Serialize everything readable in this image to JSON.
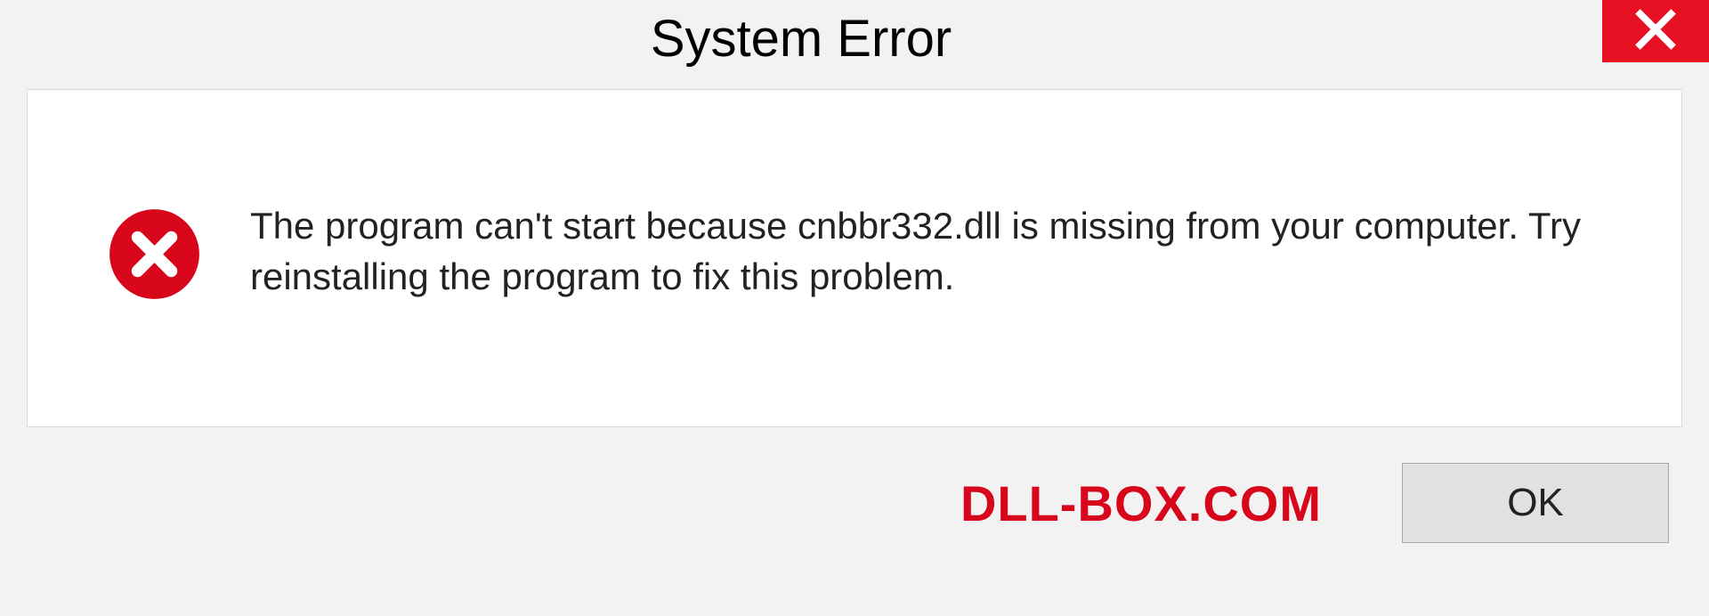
{
  "titlebar": {
    "title": "System Error"
  },
  "dialog": {
    "message": "The program can't start because cnbbr332.dll is missing from your computer. Try reinstalling the program to fix this problem."
  },
  "footer": {
    "watermark": "DLL-BOX.COM",
    "ok_label": "OK"
  },
  "colors": {
    "close_bg": "#e81123",
    "error_icon": "#d8061b",
    "watermark": "#d8061b"
  }
}
